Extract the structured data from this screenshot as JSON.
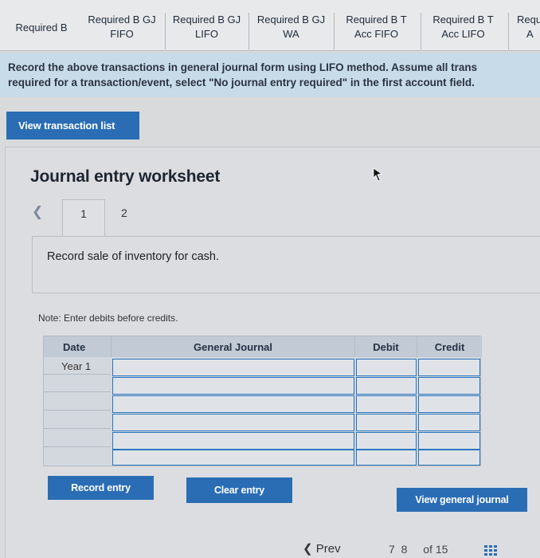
{
  "tabs": [
    {
      "l1": "Required B",
      "l2": ""
    },
    {
      "l1": "Required B GJ",
      "l2": "FIFO"
    },
    {
      "l1": "Required B GJ",
      "l2": "LIFO"
    },
    {
      "l1": "Required B GJ",
      "l2": "WA"
    },
    {
      "l1": "Required B T",
      "l2": "Acc FIFO"
    },
    {
      "l1": "Required B T",
      "l2": "Acc LIFO"
    },
    {
      "l1": "Requ",
      "l2": "A"
    }
  ],
  "instructions": {
    "line1": "Record the above transactions in general journal form using LIFO method. Assume all trans",
    "line2": "required for a transaction/event, select \"No journal entry required\" in the first account field."
  },
  "view_transaction_list": "View transaction list",
  "worksheet": {
    "title": "Journal entry worksheet",
    "pages": [
      "1",
      "2"
    ],
    "description": "Record sale of inventory for cash.",
    "note": "Note: Enter debits before credits."
  },
  "table": {
    "headers": {
      "date": "Date",
      "general_journal": "General Journal",
      "debit": "Debit",
      "credit": "Credit"
    },
    "first_date": "Year 1"
  },
  "buttons": {
    "record": "Record entry",
    "clear": "Clear entry",
    "view_general_journal": "View general journal"
  },
  "pagination": {
    "prev": "Prev",
    "pages": "7  8",
    "of": "of 15"
  }
}
